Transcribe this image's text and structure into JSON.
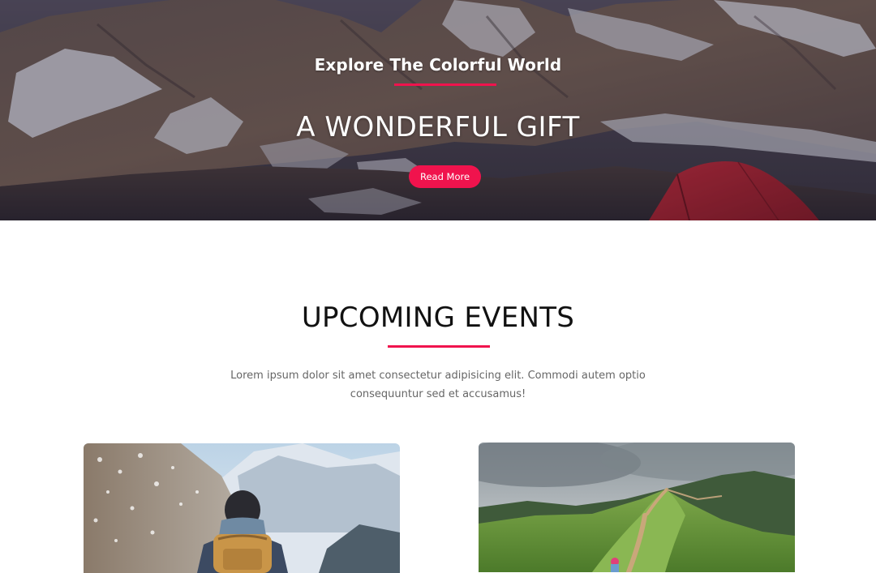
{
  "hero": {
    "kicker": "Explore The Colorful World",
    "title": "A WONDERFUL GIFT",
    "button_label": "Read More"
  },
  "events": {
    "title": "UPCOMING EVENTS",
    "description": "Lorem ipsum dolor sit amet consectetur adipisicing elit. Commodi autem optio consequuntur sed et accusamus!"
  },
  "colors": {
    "accent": "#f0134d",
    "heading": "#111111",
    "body_text": "#666666"
  }
}
